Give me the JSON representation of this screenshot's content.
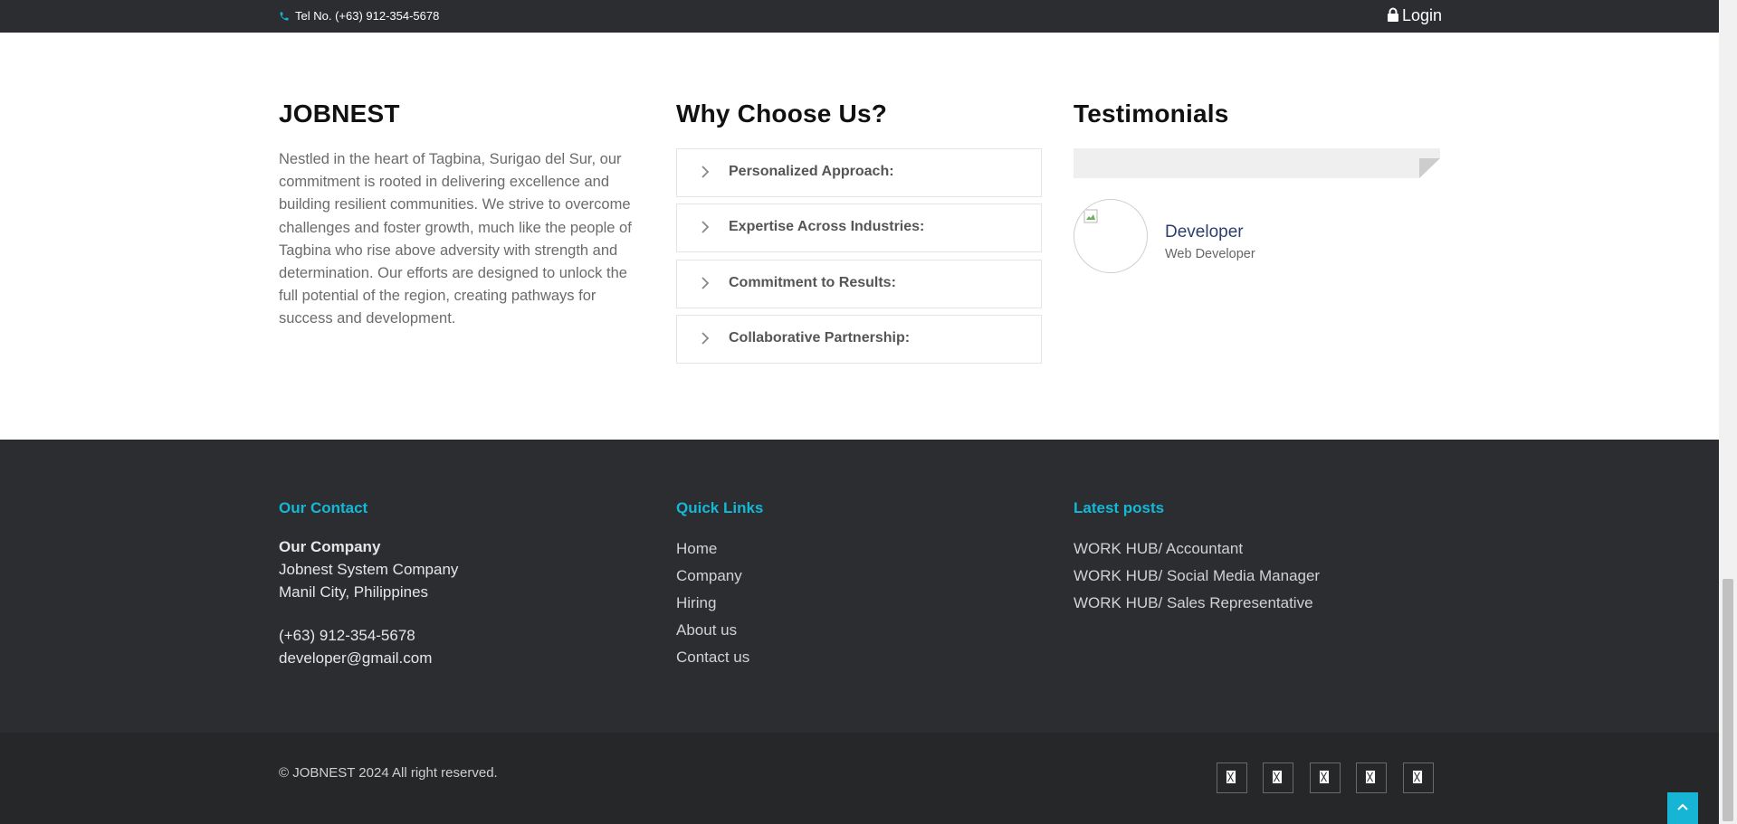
{
  "topbar": {
    "tel": "Tel No. (+63) 912-354-5678",
    "login": "Login",
    "icons": [
      "phone-icon",
      "lock-icon"
    ]
  },
  "about": {
    "title": "JOBNEST",
    "text": "Nestled in the heart of Tagbina, Surigao del Sur, our commitment is rooted in delivering excellence and building resilient communities. We strive to overcome challenges and foster growth, much like the people of Tagbina who rise above adversity with strength and determination. Our efforts are designed to unlock the full potential of the region, creating pathways for success and development."
  },
  "why": {
    "title": "Why Choose Us?",
    "items": [
      {
        "label": "Personalized Approach:"
      },
      {
        "label": "Expertise Across Industries:"
      },
      {
        "label": "Commitment to Results:"
      },
      {
        "label": "Collaborative Partnership:"
      }
    ]
  },
  "testimonials": {
    "title": "Testimonials",
    "name": "Developer",
    "role": "Web Developer"
  },
  "footer": {
    "contact": {
      "title": "Our Contact",
      "company_label": "Our Company",
      "company": "Jobnest System Company",
      "city": "Manil City, Philippines",
      "phone": "(+63) 912-354-5678",
      "email": "developer@gmail.com"
    },
    "quick_links": {
      "title": "Quick Links",
      "items": [
        "Home",
        "Company",
        "Hiring",
        "About us",
        "Contact us"
      ]
    },
    "latest_posts": {
      "title": "Latest posts",
      "items": [
        "WORK HUB/ Accountant",
        "WORK HUB/ Social Media Manager",
        "WORK HUB/ Sales Representative"
      ]
    },
    "copyright": "© JOBNEST 2024 All right reserved.",
    "social_icons": [
      "missing-glyph-icon",
      "missing-glyph-icon",
      "missing-glyph-icon",
      "missing-glyph-icon",
      "missing-glyph-icon"
    ]
  },
  "colors": {
    "dark": "#2c2d31",
    "footer_bottom": "#262729",
    "accent": "#14b8d6",
    "name": "#2a3f6e"
  }
}
